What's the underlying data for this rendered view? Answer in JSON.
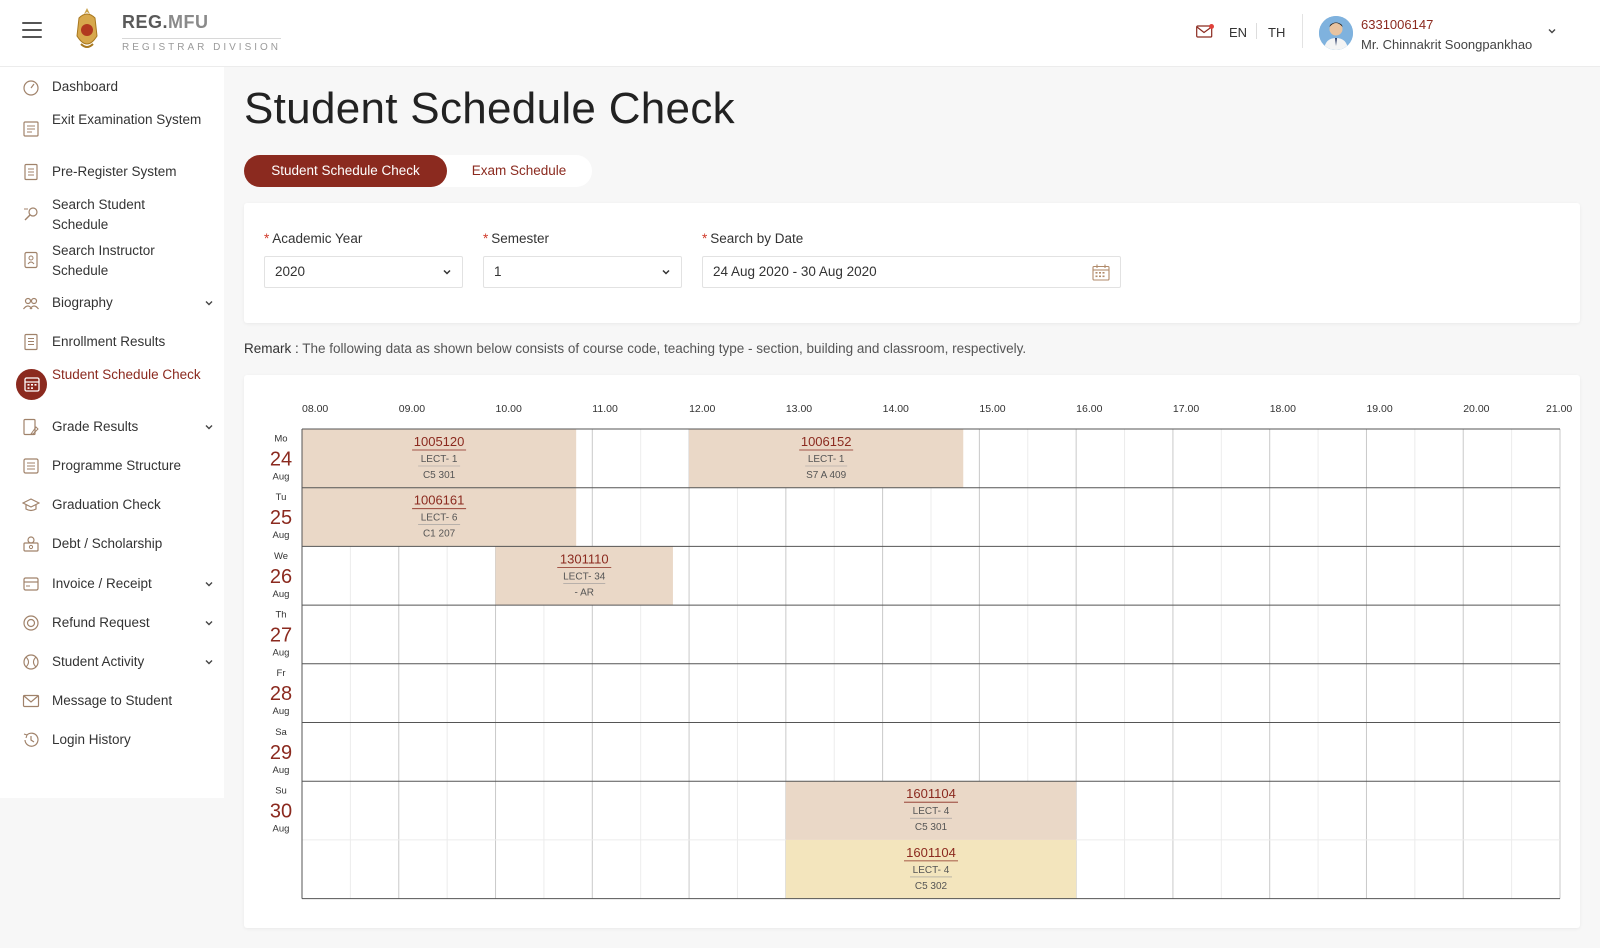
{
  "header": {
    "brand_title": "REG.",
    "brand_title_accent": "MFU",
    "brand_subtitle": "REGISTRAR DIVISION",
    "lang_en": "EN",
    "lang_th": "TH",
    "user_id": "6331006147",
    "user_name": "Mr. Chinnakrit Soongpankhao",
    "notification_dot_color": "#e0413a"
  },
  "sidebar": {
    "items": [
      {
        "label": "Dashboard",
        "icon": "dashboard-icon"
      },
      {
        "label": "Exit Examination System",
        "icon": "exam-icon"
      },
      {
        "label": "Pre-Register System",
        "icon": "register-icon"
      },
      {
        "label": "Search Student Schedule",
        "icon": "search-schedule-icon"
      },
      {
        "label": "Search Instructor Schedule",
        "icon": "instructor-icon"
      },
      {
        "label": "Biography",
        "icon": "people-icon",
        "has_submenu": true
      },
      {
        "label": "Enrollment Results",
        "icon": "enrollment-icon"
      },
      {
        "label": "Student Schedule Check",
        "icon": "calendar-icon",
        "active": true
      },
      {
        "label": "Grade Results",
        "icon": "grade-icon",
        "has_submenu": true
      },
      {
        "label": "Programme Structure",
        "icon": "list-icon"
      },
      {
        "label": "Graduation Check",
        "icon": "graduation-cap-icon"
      },
      {
        "label": "Debt / Scholarship",
        "icon": "money-icon"
      },
      {
        "label": "Invoice / Receipt",
        "icon": "invoice-icon",
        "has_submenu": true
      },
      {
        "label": "Refund Request",
        "icon": "refund-icon",
        "has_submenu": true
      },
      {
        "label": "Student Activity",
        "icon": "activity-icon",
        "has_submenu": true
      },
      {
        "label": "Message to Student",
        "icon": "mail-icon"
      },
      {
        "label": "Login History",
        "icon": "history-icon"
      }
    ]
  },
  "main": {
    "title": "Student Schedule Check",
    "tabs": [
      {
        "label": "Student Schedule Check",
        "active": true
      },
      {
        "label": "Exam Schedule",
        "active": false
      }
    ],
    "filters": {
      "academic_year_label": "Academic Year",
      "academic_year_value": "2020",
      "semester_label": "Semester",
      "semester_value": "1",
      "date_label": "Search by Date",
      "date_value": "24 Aug 2020 - 30 Aug 2020"
    },
    "remark_label": "Remark :",
    "remark_text": " The following data as shown below consists of course code, teaching type - section, building and classroom, respectively."
  },
  "colors": {
    "brand": "#8b2a1f",
    "event_primary": "#ead8c7",
    "event_secondary": "#f3e5bd"
  },
  "schedule": {
    "hours": [
      "08.00",
      "09.00",
      "10.00",
      "11.00",
      "12.00",
      "13.00",
      "14.00",
      "15.00",
      "16.00",
      "17.00",
      "18.00",
      "19.00",
      "20.00",
      "21.00"
    ],
    "days": [
      {
        "dow": "Mo",
        "date": "24",
        "month": "Aug",
        "rows": 1
      },
      {
        "dow": "Tu",
        "date": "25",
        "month": "Aug",
        "rows": 1
      },
      {
        "dow": "We",
        "date": "26",
        "month": "Aug",
        "rows": 1
      },
      {
        "dow": "Th",
        "date": "27",
        "month": "Aug",
        "rows": 1
      },
      {
        "dow": "Fr",
        "date": "28",
        "month": "Aug",
        "rows": 1
      },
      {
        "dow": "Sa",
        "date": "29",
        "month": "Aug",
        "rows": 1
      },
      {
        "dow": "Su",
        "date": "30",
        "month": "Aug",
        "rows": 2
      }
    ],
    "events": [
      {
        "day": 0,
        "row": 0,
        "start": "08.00",
        "end": "10.50",
        "code": "1005120",
        "type": "LECT- 1",
        "room": "C5 301",
        "style": "primary"
      },
      {
        "day": 0,
        "row": 0,
        "start": "12.00",
        "end": "14.50",
        "code": "1006152",
        "type": "LECT- 1",
        "room": "S7 A 409",
        "style": "primary"
      },
      {
        "day": 1,
        "row": 0,
        "start": "08.00",
        "end": "10.50",
        "code": "1006161",
        "type": "LECT- 6",
        "room": "C1 207",
        "style": "primary"
      },
      {
        "day": 2,
        "row": 0,
        "start": "10.00",
        "end": "11.50",
        "code": "1301110",
        "type": "LECT- 34",
        "room": "- AR",
        "style": "primary"
      },
      {
        "day": 6,
        "row": 0,
        "start": "13.00",
        "end": "16.00",
        "code": "1601104",
        "type": "LECT- 4",
        "room": "C5 301",
        "style": "primary"
      },
      {
        "day": 6,
        "row": 1,
        "start": "13.00",
        "end": "16.00",
        "code": "1601104",
        "type": "LECT- 4",
        "room": "C5 302",
        "style": "secondary"
      }
    ]
  }
}
